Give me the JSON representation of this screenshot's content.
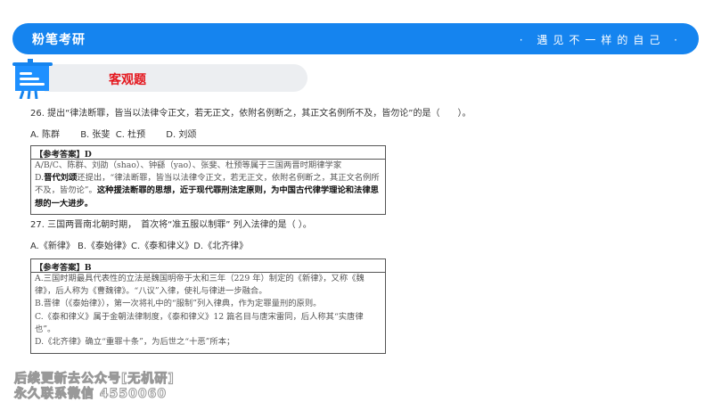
{
  "header": {
    "logo": "粉笔考研",
    "slogan": "· 遇见不一样的自己 ·",
    "brand_color": "#1584ef"
  },
  "section": {
    "title": "客观题"
  },
  "q26": {
    "stem": "26. 提出“律法断罪，皆当以法律令正文，若无正文，依附名例断之，其正文名例所不及，皆勿论”的是（　　）。",
    "options": "A. 陈群　　 B. 张斐  C. 杜预　　 D. 刘颂",
    "answer_header": "【参考答案】D",
    "lines": [
      "A/B/C、陈群、刘劭（shao）、钟繇（yao）、张斐、杜预等属于三国两晋时期律学家"
    ],
    "d_bold": "晋代刘颂",
    "d_rest": "还提出，“律法断罪，皆当以法律令正文，若无正文，依附名例断之，其正文名例所不及，皆勿论”。",
    "d_prefix": "D.",
    "d_conclusion": "这种援法断罪的思想，近于现代罪刑法定原则，为中国古代律学理论和法律思想的一大进步。"
  },
  "q27": {
    "stem": "27. 三国两晋南北朝时期，　首次将“准五服以制罪” 列入法律的是（ ）。",
    "options": "A.《新律》 B.《泰始律》C.《泰和律义》D.《北齐律》",
    "answer_header": "【参考答案】B",
    "lines": [
      "A.三国时期最具代表性的立法是魏国明帝于太和三年（229 年）制定的《新律》，又称《魏律》，后人称为《曹魏律》。“八议”入律，使礼与律进一步融合。",
      "B.晋律（《泰始律》），第一次将礼中的“服制”列入律典，作为定罪量刑的原则。",
      "C.《泰和律义》属于金朝法律制度，《泰和律义》12 篇名目与唐宋雷同，后人称其“实唐律也”。",
      "D.《北齐律》确立“重罪十条”，为后世之“十恶”所本；"
    ]
  },
  "watermark": {
    "line1": "后续更新去公众号[无机研]",
    "line2": "永久联系微信 4550060"
  }
}
